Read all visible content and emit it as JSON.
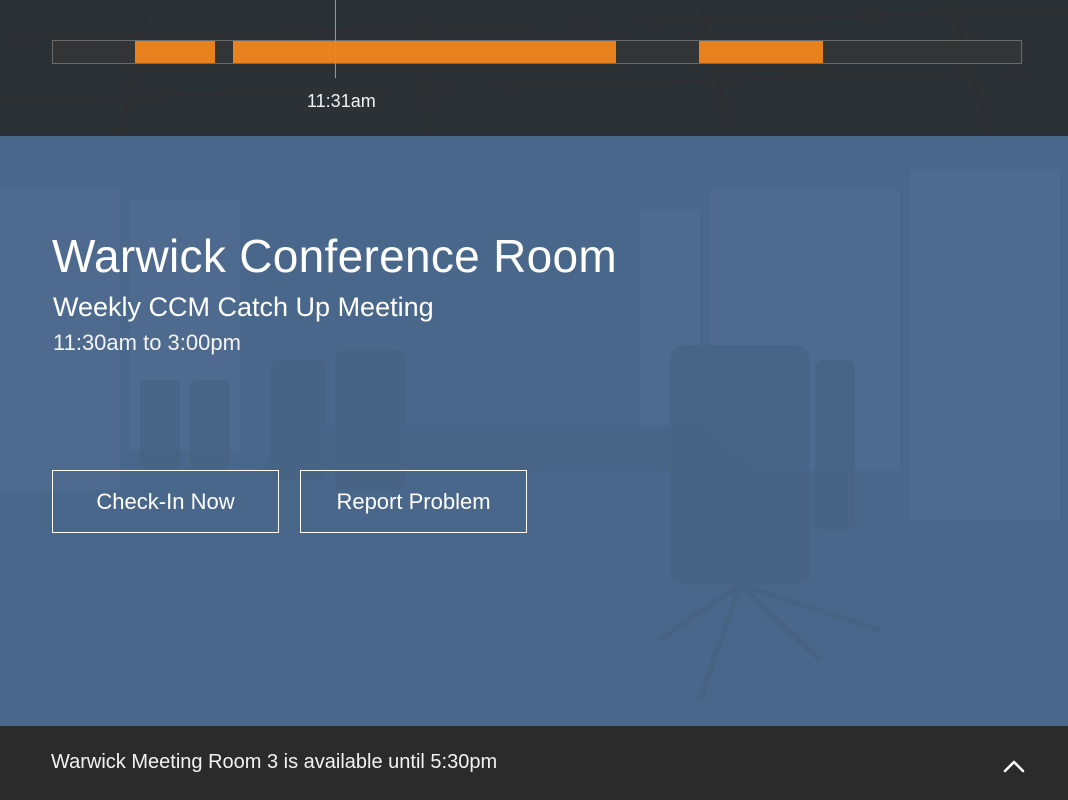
{
  "timeline": {
    "current_time": "11:31am",
    "bookings": [
      {
        "start_fraction": 0.085,
        "end_fraction": 0.168
      },
      {
        "start_fraction": 0.186,
        "end_fraction": 0.582
      },
      {
        "start_fraction": 0.667,
        "end_fraction": 0.795
      }
    ],
    "now_fraction": 0.29
  },
  "room": {
    "name": "Warwick Conference Room"
  },
  "meeting": {
    "title": "Weekly CCM Catch Up Meeting",
    "time": "11:30am to 3:00pm"
  },
  "actions": {
    "checkin_label": "Check-In Now",
    "report_label": "Report Problem"
  },
  "footer": {
    "availability_text": "Warwick Meeting Room 3 is available until 5:30pm",
    "expand_icon": "chevron-up-icon"
  },
  "colors": {
    "booking": "#e8821e",
    "panel": "#4e6c90",
    "footer": "#2b2b2b"
  }
}
